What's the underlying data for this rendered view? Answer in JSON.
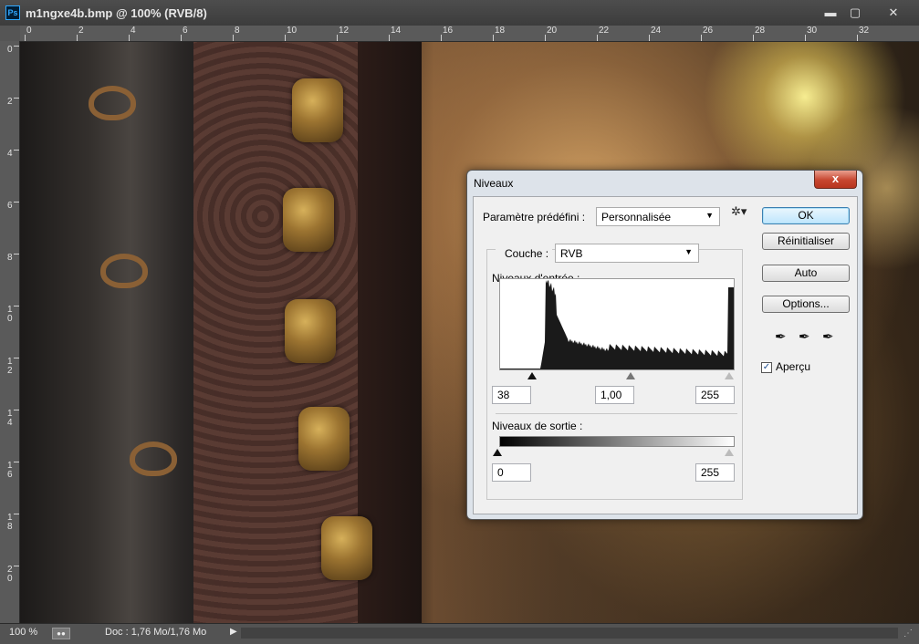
{
  "window": {
    "app_icon": "Ps",
    "title": "m1ngxe4b.bmp @ 100% (RVB/8)",
    "min_label": "▬",
    "max_label": "▢",
    "close_label": "✕"
  },
  "ruler_top_labels": [
    "0",
    "2",
    "4",
    "6",
    "8",
    "10",
    "12",
    "14",
    "16",
    "18",
    "20",
    "22",
    "24",
    "26",
    "28",
    "30",
    "32"
  ],
  "ruler_left_labels": [
    "0",
    "2",
    "4",
    "6",
    "8",
    "1\n0",
    "1\n2",
    "1\n4",
    "1\n6",
    "1\n8",
    "2\n0"
  ],
  "statusbar": {
    "zoom": "100 %",
    "doc_info": "Doc : 1,76 Mo/1,76 Mo",
    "arrow": "▶"
  },
  "dialog": {
    "title": "Niveaux",
    "close_label": "x",
    "preset_label": "Paramètre prédéfini :",
    "preset_value": "Personnalisée",
    "channel_label": "Couche :",
    "channel_value": "RVB",
    "input_levels_label": "Niveaux d'entrée :",
    "input_black": "38",
    "input_gamma": "1,00",
    "input_white": "255",
    "output_levels_label": "Niveaux de sortie :",
    "output_black": "0",
    "output_white": "255",
    "buttons": {
      "ok": "OK",
      "reset": "Réinitialiser",
      "auto": "Auto",
      "options": "Options..."
    },
    "preview_label": "Aperçu",
    "preview_checked": true,
    "eyedroppers": [
      "black-eyedropper-icon",
      "gray-eyedropper-icon",
      "white-eyedropper-icon"
    ]
  }
}
